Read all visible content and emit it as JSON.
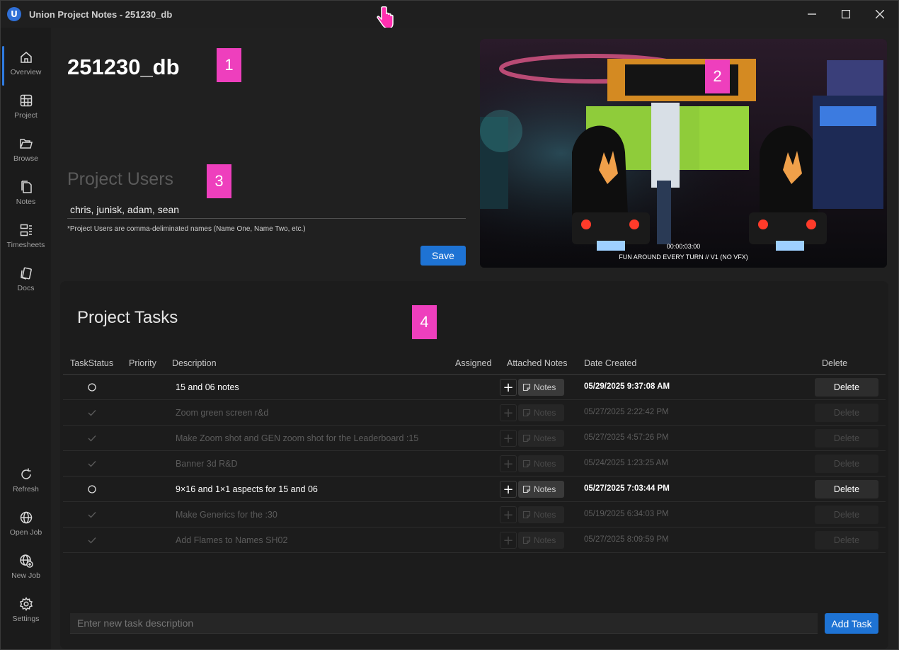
{
  "window": {
    "title": "Union Project Notes - 251230_db",
    "logo_letter": "U"
  },
  "sidebar": {
    "items": [
      {
        "label": "Overview",
        "icon": "home-icon"
      },
      {
        "label": "Project",
        "icon": "table-icon"
      },
      {
        "label": "Browse",
        "icon": "folder-icon"
      },
      {
        "label": "Notes",
        "icon": "notes-icon"
      },
      {
        "label": "Timesheets",
        "icon": "timesheet-icon"
      },
      {
        "label": "Docs",
        "icon": "docs-icon"
      }
    ],
    "bottom_items": [
      {
        "label": "Refresh",
        "icon": "refresh-icon"
      },
      {
        "label": "Open Job",
        "icon": "globe-icon"
      },
      {
        "label": "New Job",
        "icon": "globe-plus-icon"
      },
      {
        "label": "Settings",
        "icon": "gear-icon"
      }
    ]
  },
  "overview": {
    "job_title": "251230_db",
    "users_heading": "Project Users",
    "users_value": "chris, junisk, adam, sean",
    "users_hint": "*Project Users are comma-deliminated names (Name One, Name Two, etc.)",
    "save_label": "Save"
  },
  "preview": {
    "timecode": "00:00:03:00",
    "caption": "FUN AROUND EVERY TURN // V1 (NO VFX)"
  },
  "badges": [
    "1",
    "2",
    "3",
    "4"
  ],
  "tasks": {
    "heading": "Project Tasks",
    "columns": {
      "status": "TaskStatus",
      "priority": "Priority",
      "description": "Description",
      "assigned": "Assigned",
      "notes": "Attached Notes",
      "date": "Date Created",
      "delete": "Delete"
    },
    "notes_label": "Notes",
    "delete_label": "Delete",
    "rows": [
      {
        "status": "open",
        "description": "15 and 06 notes",
        "date": "05/29/2025 9:37:08 AM"
      },
      {
        "status": "done",
        "description": "Zoom green screen r&d",
        "date": "05/27/2025 2:22:42 PM"
      },
      {
        "status": "done",
        "description": "Make Zoom shot and GEN zoom shot for the Leaderboard :15",
        "date": "05/27/2025 4:57:26 PM"
      },
      {
        "status": "done",
        "description": "Banner 3d R&D",
        "date": "05/24/2025 1:23:25 AM"
      },
      {
        "status": "open",
        "description": "9×16 and 1×1 aspects for 15 and 06",
        "date": "05/27/2025 7:03:44 PM"
      },
      {
        "status": "done",
        "description": "Make Generics for the :30",
        "date": "05/19/2025 6:34:03 PM"
      },
      {
        "status": "done",
        "description": "Add Flames to Names SH02",
        "date": "05/27/2025 8:09:59 PM"
      }
    ],
    "new_task_placeholder": "Enter new task description",
    "add_task_label": "Add Task"
  },
  "colors": {
    "accent": "#1e73d4",
    "badge": "#ee3fbd",
    "background": "#202020"
  }
}
